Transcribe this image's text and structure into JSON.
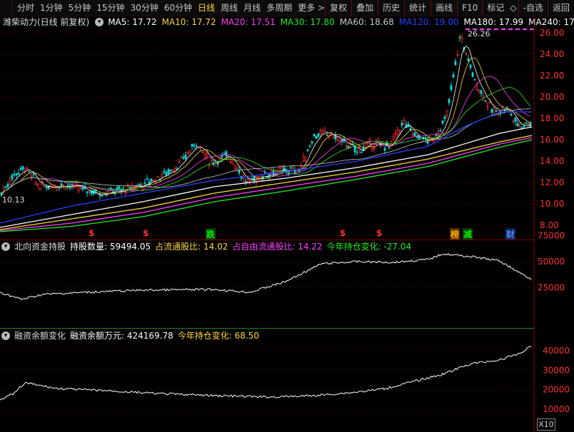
{
  "toolbar": {
    "periods": [
      "分时",
      "1分钟",
      "5分钟",
      "15分钟",
      "30分钟",
      "60分钟",
      "日线",
      "周线",
      "月线",
      "多周期",
      "更多 >"
    ],
    "active_period": "日线",
    "tools": [
      "复权",
      "叠加",
      "历史",
      "统计",
      "画线",
      "F10",
      "标记",
      "-自选",
      "返回"
    ],
    "diamond_icon": "◇"
  },
  "main": {
    "stock_title": "潍柴动力(日线 前复权)",
    "ma": [
      {
        "label": "MA5: 17.72",
        "color": "#ffffff"
      },
      {
        "label": "MA10: 17.72",
        "color": "#ffd83a"
      },
      {
        "label": "MA20: 17.51",
        "color": "#ff40ff"
      },
      {
        "label": "MA30: 17.80",
        "color": "#22ee22"
      },
      {
        "label": "MA60: 18.68",
        "color": "#c8c8c8"
      },
      {
        "label": "MA120: 19.00",
        "color": "#2244ff"
      },
      {
        "label": "MA180: 17.99",
        "color": "#ffffff"
      },
      {
        "label": "MA240: 17.",
        "color": "#ffffff"
      }
    ],
    "y_ticks": [
      "26.00",
      "24.00",
      "22.00",
      "20.00",
      "18.00",
      "16.00",
      "14.00",
      "12.00",
      "10.00",
      "8.00"
    ],
    "high_label": "26.26",
    "low_label": "10.13",
    "markers": [
      {
        "text": "$",
        "color": "#ff3030"
      },
      {
        "text": "$",
        "color": "#ff3030"
      },
      {
        "text": "跌",
        "color": "#00ee00"
      },
      {
        "text": "$",
        "color": "#ff3030"
      },
      {
        "text": "$",
        "color": "#ff3030"
      },
      {
        "text": "榜",
        "color": "#ffaa00"
      },
      {
        "text": "减",
        "color": "#00ee00"
      },
      {
        "text": "财",
        "color": "#4488ff"
      }
    ]
  },
  "north": {
    "title": "北向资金持股",
    "hold_label": "持股数量: 59494.05",
    "ratio_label": "占流通股比: 14.02",
    "free_ratio_label": "占自由流通股比: 14.22",
    "year_change_label": "今年持仓变化: -27.04",
    "y_ticks": [
      "75000",
      "50000",
      "25000"
    ]
  },
  "margin": {
    "title": "融资余额变化",
    "balance_label": "融资余额万元: 424169.78",
    "year_change_label": "今年持仓变化: 68.50",
    "y_ticks": [
      "40000",
      "30000",
      "20000",
      "10000"
    ],
    "scale_badge": "X10"
  }
}
